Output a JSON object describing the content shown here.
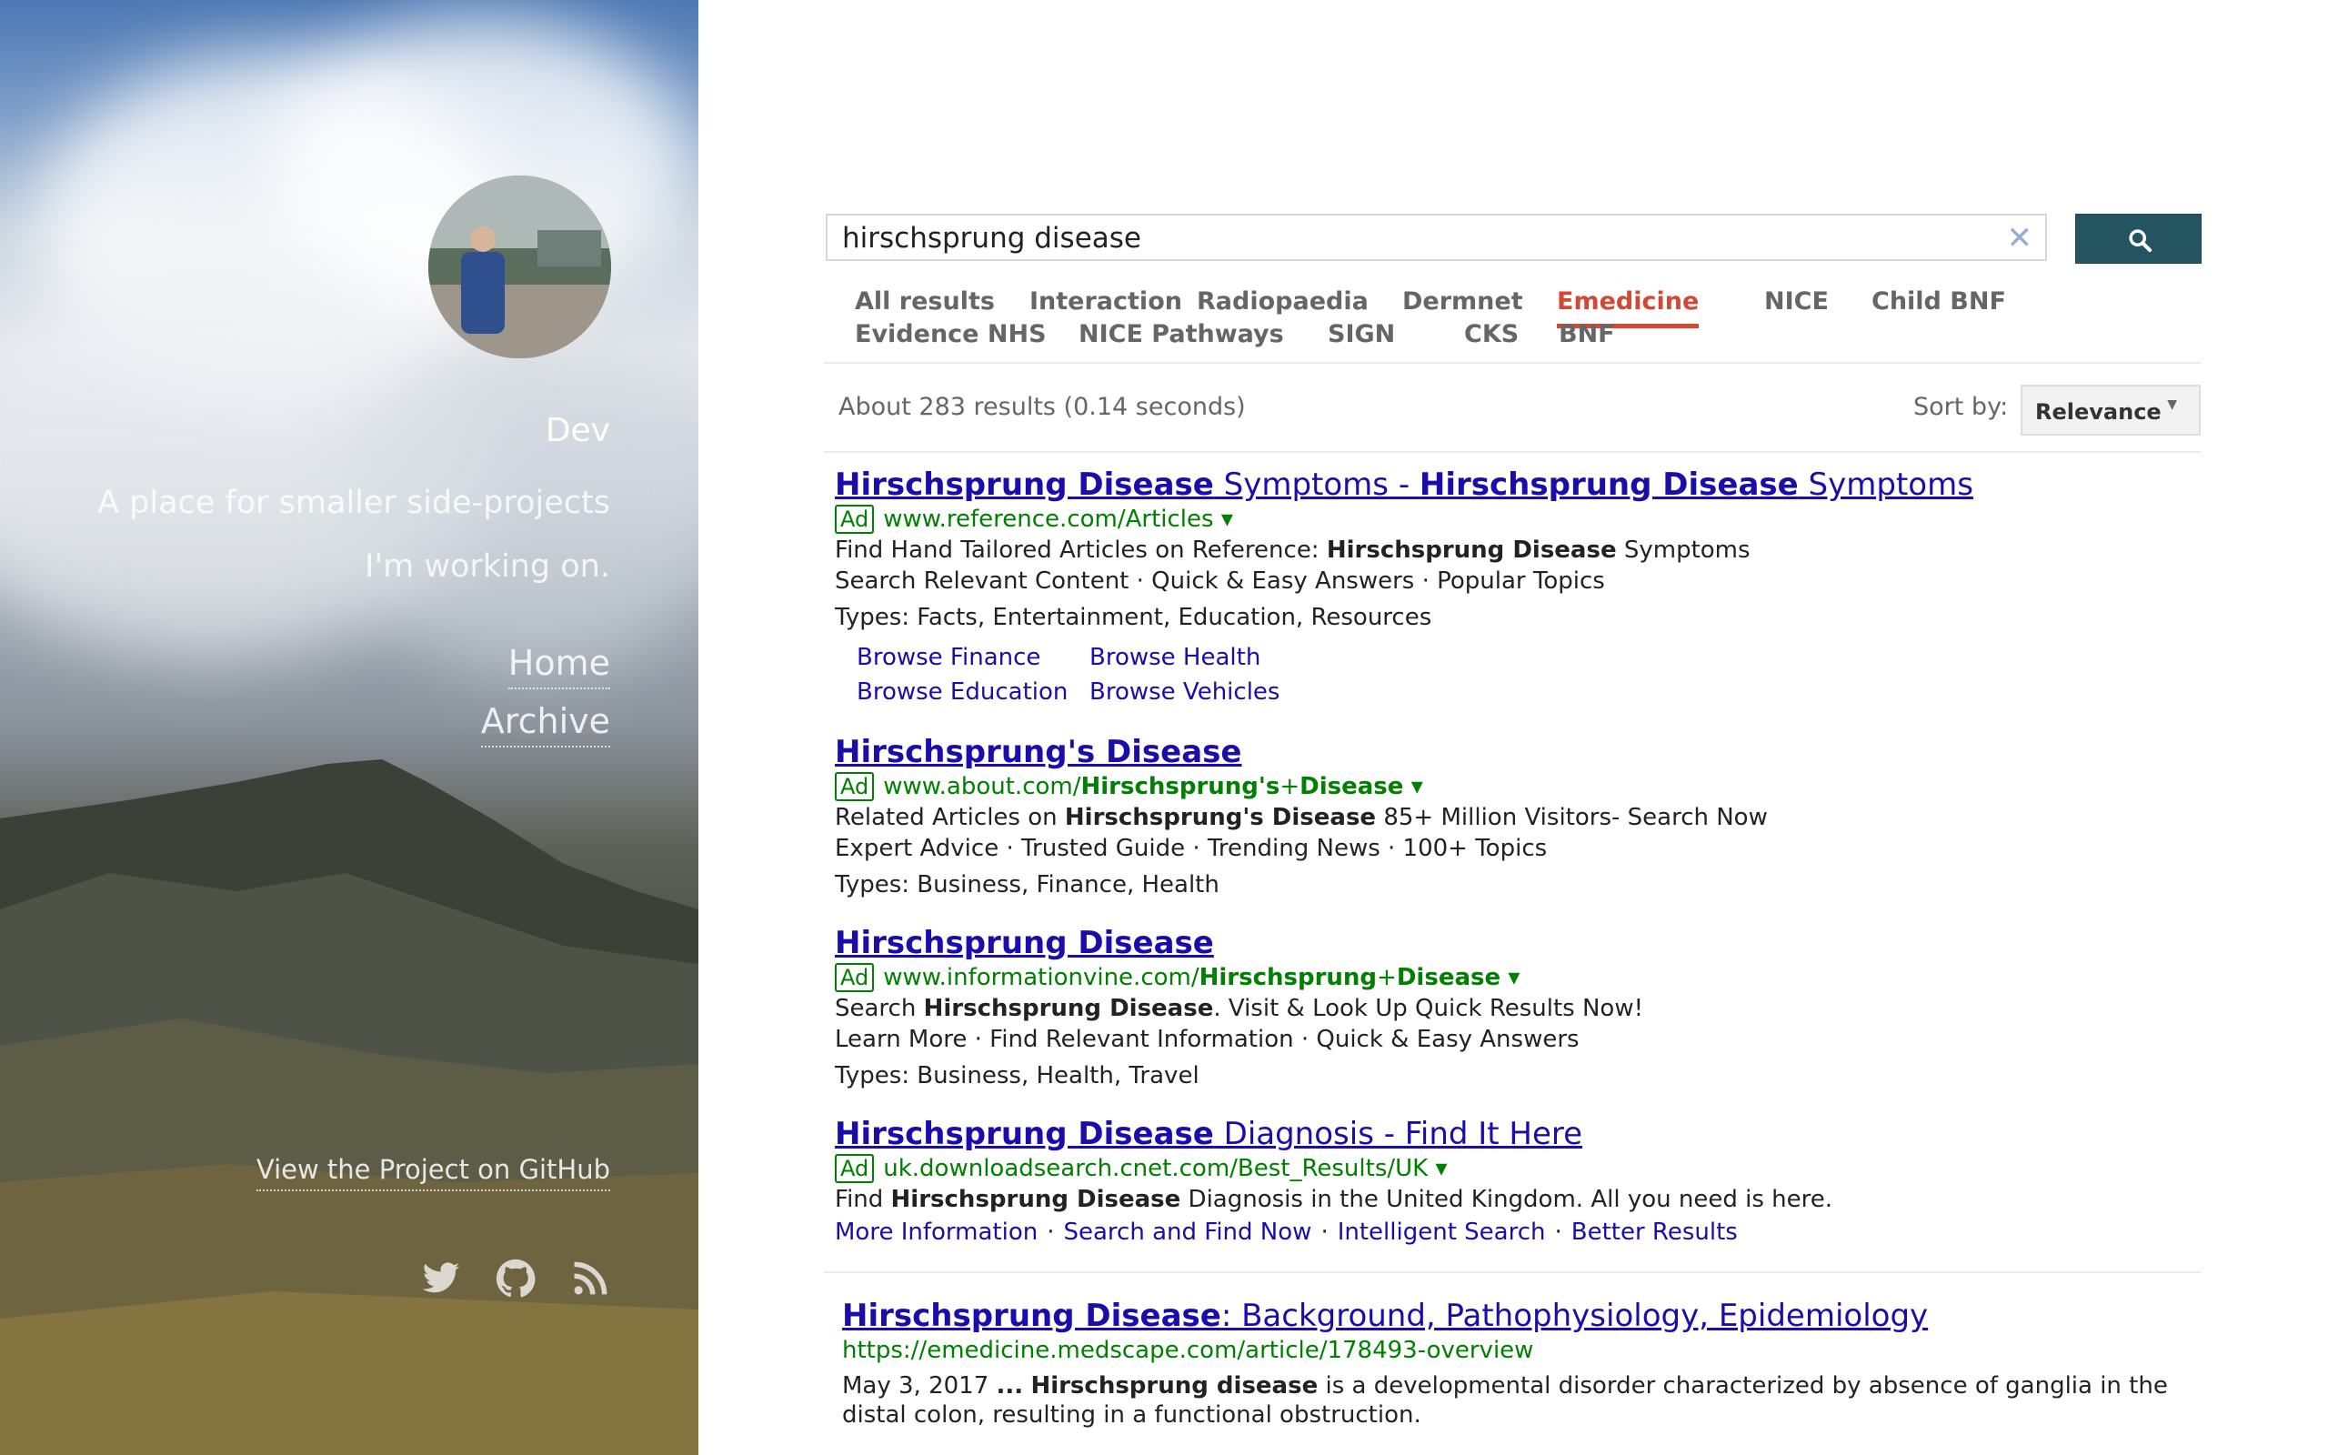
{
  "sidebar": {
    "site_title": "Dev",
    "tagline": "A place for smaller side-projects I'm working on.",
    "nav": [
      "Home",
      "Archive"
    ],
    "github_link": "View the Project on GitHub",
    "social_icons": [
      "twitter-icon",
      "github-icon",
      "rss-icon"
    ]
  },
  "search": {
    "query": "hirschsprung disease",
    "clear_icon": "✕",
    "button_icon": "search-icon"
  },
  "tabs": [
    {
      "label": "All results",
      "active": false
    },
    {
      "label": "Interaction",
      "active": false
    },
    {
      "label": "Radiopaedia",
      "active": false
    },
    {
      "label": "Dermnet",
      "active": false
    },
    {
      "label": "Emedicine",
      "active": true
    },
    {
      "label": "NICE",
      "active": false
    },
    {
      "label": "Child BNF",
      "active": false
    },
    {
      "label": "Evidence NHS",
      "active": false
    },
    {
      "label": "NICE Pathways",
      "active": false
    },
    {
      "label": "SIGN",
      "active": false
    },
    {
      "label": "CKS",
      "active": false
    },
    {
      "label": "BNF",
      "active": false
    }
  ],
  "results_info": "About 283 results (0.14 seconds)",
  "sort": {
    "label": "Sort by:",
    "value": "Relevance"
  },
  "ads": [
    {
      "title_parts": [
        {
          "text": "Hirschsprung Disease",
          "bold": true
        },
        {
          "text": " Symptoms - ",
          "bold": false
        },
        {
          "text": "Hirschsprung Disease",
          "bold": true
        },
        {
          "text": " Symptoms",
          "bold": false
        }
      ],
      "badge": "Ad",
      "url_parts": [
        {
          "text": "www.reference.com/Articles",
          "bold": false
        }
      ],
      "desc1_parts": [
        {
          "text": "Find Hand Tailored Articles on Reference: ",
          "bold": false
        },
        {
          "text": "Hirschsprung Disease",
          "bold": true
        },
        {
          "text": " Symptoms",
          "bold": false
        }
      ],
      "desc2": "Search Relevant Content · Quick & Easy Answers · Popular Topics",
      "types": "Types: Facts, Entertainment, Education, Resources",
      "sitelinks": [
        "Browse Finance",
        "Browse Health",
        "Browse Education",
        "Browse Vehicles"
      ]
    },
    {
      "title_parts": [
        {
          "text": "Hirschsprung's Disease",
          "bold": true
        }
      ],
      "badge": "Ad",
      "url_parts": [
        {
          "text": "www.about.com/",
          "bold": false
        },
        {
          "text": "Hirschsprung's",
          "bold": true
        },
        {
          "text": "+",
          "bold": false
        },
        {
          "text": "Disease",
          "bold": true
        }
      ],
      "desc1_parts": [
        {
          "text": "Related Articles on ",
          "bold": false
        },
        {
          "text": "Hirschsprung's Disease",
          "bold": true
        },
        {
          "text": " 85+ Million Visitors- Search Now",
          "bold": false
        }
      ],
      "desc2": "Expert Advice · Trusted Guide · Trending News · 100+ Topics",
      "types": "Types: Business, Finance, Health"
    },
    {
      "title_parts": [
        {
          "text": "Hirschsprung Disease",
          "bold": true
        }
      ],
      "badge": "Ad",
      "url_parts": [
        {
          "text": "www.informationvine.com/",
          "bold": false
        },
        {
          "text": "Hirschsprung",
          "bold": true
        },
        {
          "text": "+",
          "bold": false
        },
        {
          "text": "Disease",
          "bold": true
        }
      ],
      "desc1_parts": [
        {
          "text": "Search ",
          "bold": false
        },
        {
          "text": "Hirschsprung Disease",
          "bold": true
        },
        {
          "text": ". Visit & Look Up Quick Results Now!",
          "bold": false
        }
      ],
      "desc2": "Learn More · Find Relevant Information · Quick & Easy Answers",
      "types": "Types: Business, Health, Travel"
    },
    {
      "title_parts": [
        {
          "text": "Hirschsprung Disease",
          "bold": true
        },
        {
          "text": " Diagnosis - Find It Here",
          "bold": false
        }
      ],
      "badge": "Ad",
      "url_parts": [
        {
          "text": "uk.downloadsearch.cnet.com/Best_Results/UK",
          "bold": false
        }
      ],
      "desc1_parts": [
        {
          "text": "Find ",
          "bold": false
        },
        {
          "text": "Hirschsprung Disease",
          "bold": true
        },
        {
          "text": " Diagnosis in the United Kingdom. All you need is here.",
          "bold": false
        }
      ],
      "inline_links": [
        "More Information",
        "Search and Find Now",
        "Intelligent Search",
        "Better Results"
      ]
    }
  ],
  "organic": {
    "title_parts": [
      {
        "text": "Hirschsprung Disease",
        "bold": true
      },
      {
        "text": ": Background, Pathophysiology, Epidemiology",
        "bold": false
      }
    ],
    "url": "https://emedicine.medscape.com/article/178493-overview",
    "snippet_parts": [
      {
        "text": "May 3, 2017 ",
        "bold": false
      },
      {
        "text": "...",
        "bold": true
      },
      {
        "text": " ",
        "bold": false
      },
      {
        "text": "Hirschsprung disease",
        "bold": true
      },
      {
        "text": " is a developmental disorder characterized by absence of ganglia in the distal colon, resulting in a functional obstruction.",
        "bold": false
      }
    ]
  },
  "colors": {
    "link": "#1a0dab",
    "url_green": "#008000",
    "active_tab": "#d14836",
    "search_button": "#23545f"
  }
}
